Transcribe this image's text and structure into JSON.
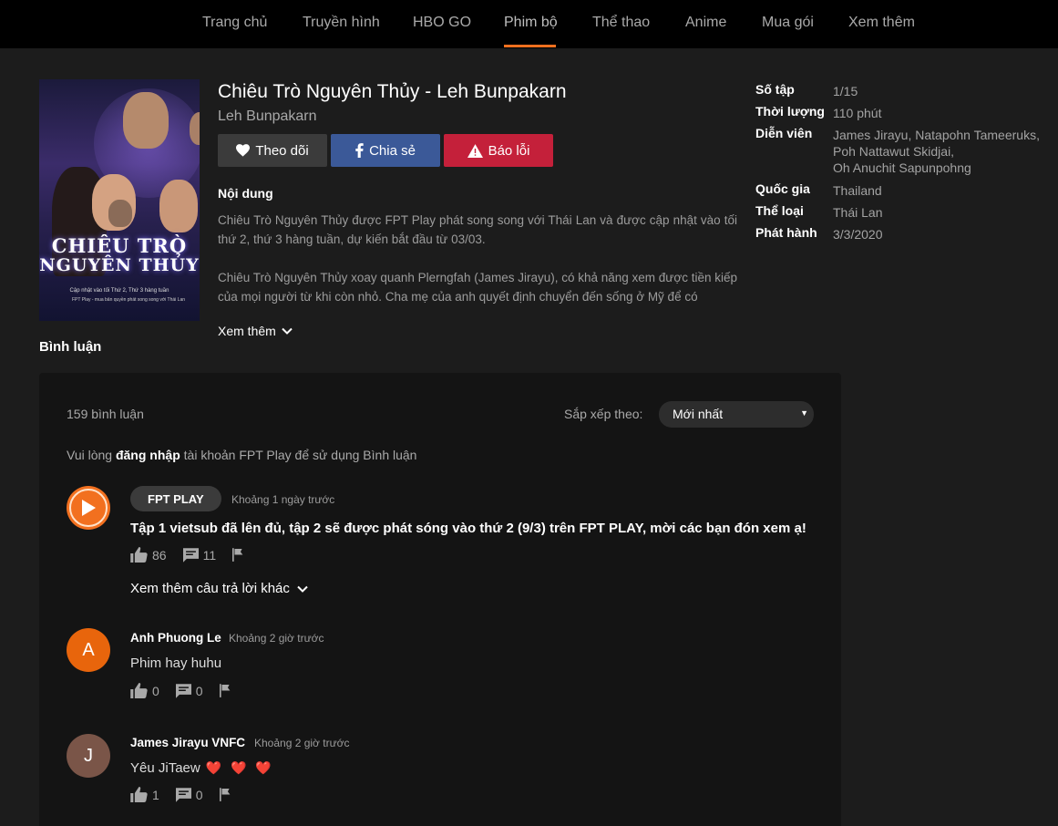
{
  "nav": {
    "items": [
      "Trang chủ",
      "Truyền hình",
      "HBO GO",
      "Phim bộ",
      "Thể thao",
      "Anime",
      "Mua gói",
      "Xem thêm"
    ],
    "active": "Phim bộ"
  },
  "poster": {
    "title_line1": "CHIÊU TRÒ",
    "title_line2": "NGUYÊN THỦY",
    "caption": "Cập nhật vào tối Thứ 2, Thứ 3 hàng tuần",
    "caption2": "FPT Play - mua bản quyền phát song song với Thái Lan"
  },
  "movie": {
    "title": "Chiêu Trò Nguyên Thủy - Leh Bunpakarn",
    "original_title": "Leh Bunpakarn"
  },
  "buttons": {
    "follow": "Theo dõi",
    "share": "Chia sẻ",
    "report": "Báo lỗi"
  },
  "content": {
    "heading": "Nội dung",
    "paragraph1": "Chiêu Trò Nguyên Thủy được FPT Play phát song song với Thái Lan và được cập nhật vào tối thứ 2, thứ 3 hàng tuần, dự kiến bắt đầu từ 03/03.",
    "paragraph2": "Chiêu Trò Nguyên Thủy xoay quanh Plerngfah (James Jirayu), có khả năng xem được tiền kiếp của mọi người từ khi còn nhỏ. Cha mẹ của anh quyết định chuyển đến sống ở Mỹ để có",
    "more": "Xem thêm"
  },
  "meta": {
    "episodes_label": "Số tập",
    "episodes": "1/15",
    "duration_label": "Thời lượng",
    "duration": "110 phút",
    "cast_label": "Diễn viên",
    "cast": [
      "James Jirayu, Natapohn Tameeruks,",
      "Poh Nattawut Skidjai,",
      "Oh Anuchit Sapunpohng"
    ],
    "country_label": "Quốc gia",
    "country": "Thailand",
    "genre_label": "Thể loại",
    "genre": "Thái Lan",
    "release_label": "Phát hành",
    "release": "3/3/2020"
  },
  "comments": {
    "heading": "Bình luận",
    "count": "159 bình luận",
    "sort_label": "Sắp xếp theo:",
    "sort_value": "Mới nhất",
    "login_prefix": "Vui lòng",
    "login_link": "đăng nhập",
    "login_suffix": "tài khoản FPT Play để sử dụng Bình luận",
    "more_replies": "Xem thêm câu trả lời khác",
    "items": [
      {
        "author": "FPT PLAY",
        "time": "Khoảng 1 ngày trước",
        "text": "Tập 1 vietsub đã lên đủ, tập 2 sẽ được phát sóng vào thứ 2 (9/3) trên FPT PLAY, mời các bạn đón xem ạ!",
        "likes": "86",
        "replies": "11"
      },
      {
        "author": "Anh Phuong Le",
        "initial": "A",
        "time": "Khoảng 2 giờ trước",
        "text": "Phim hay huhu",
        "likes": "0",
        "replies": "0",
        "avatar_color": "#e8650c"
      },
      {
        "author": "James Jirayu VNFC",
        "initial": "J",
        "time": "Khoảng 2 giờ trước",
        "text": "Yêu JiTaew",
        "emoji": "❤️ ❤️ ❤️",
        "likes": "1",
        "replies": "0",
        "avatar_color": "#7a5548"
      }
    ]
  },
  "colors": {
    "accent": "#f2701f",
    "share": "#3b5998",
    "report": "#c4203a"
  }
}
